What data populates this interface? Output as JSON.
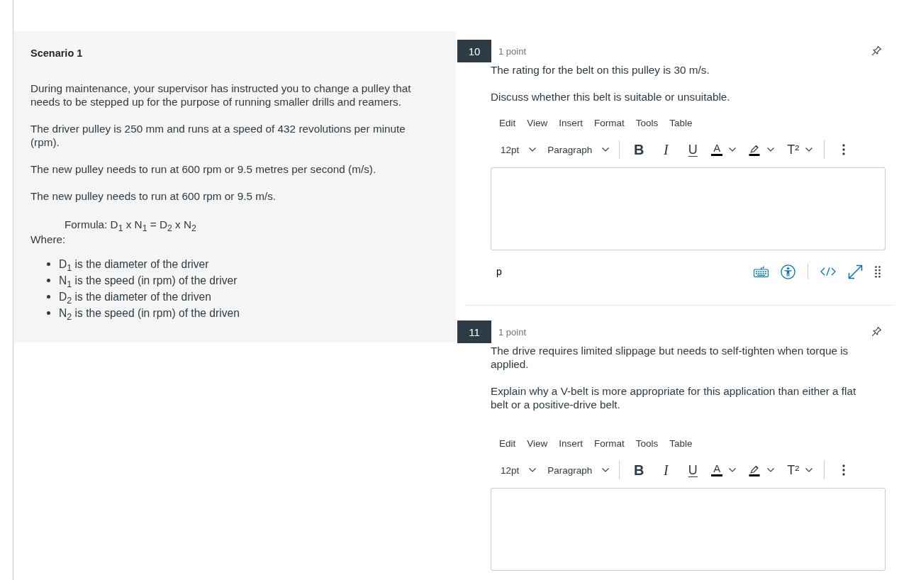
{
  "scenario": {
    "title": "Scenario 1",
    "paragraphs": [
      "During maintenance, your supervisor has instructed you to change a pulley that needs to be stepped up for the purpose of running smaller drills and reamers.",
      "The driver pulley is 250 mm and runs at a speed of 432 revolutions per minute (rpm).",
      "The new pulley needs to run at 600 rpm or 9.5 metres per second (m/s).",
      "The new pulley needs to run at 600 rpm or 9.5 m/s."
    ],
    "formula": "Formula: D$_{1}$ x N$_{1}$ = D$_{2}$ x N$_{2}$",
    "where": "Where:",
    "definitions": [
      "D$_{1}$ is the diameter of the driver",
      "N$_{1}$ is the speed (in rpm) of the driver",
      "D$_{2}$ is the diameter of the driven",
      "N$_{2}$ is the speed (in rpm) of the driven"
    ]
  },
  "questions": [
    {
      "number": "10",
      "points": "1 point",
      "paragraphs": [
        "The rating for the belt on this pulley is 30 m/s.",
        "Discuss whether this belt is suitable or unsuitable."
      ],
      "editor": {
        "menu": [
          "Edit",
          "View",
          "Insert",
          "Format",
          "Tools",
          "Table"
        ],
        "toolbar": [
          [
            {
              "kind": "font_size",
              "label": "12pt"
            },
            {
              "kind": "block_format",
              "label": "Paragraph"
            }
          ],
          [
            {
              "kind": "bold",
              "label": "B"
            },
            {
              "kind": "italic",
              "label": "I"
            },
            {
              "kind": "underline",
              "label": "U"
            },
            {
              "kind": "text_color",
              "label": "A"
            },
            {
              "kind": "highlight"
            },
            {
              "kind": "superscript",
              "label": "T²"
            }
          ],
          [
            {
              "kind": "more"
            }
          ]
        ],
        "status_path": "p"
      }
    },
    {
      "number": "11",
      "points": "1 point",
      "paragraphs": [
        "The drive requires limited slippage but needs to self-tighten when torque is applied.",
        "Explain why a V-belt is more appropriate for this application than either a flat belt or a positive-drive belt."
      ],
      "editor": {
        "menu": [
          "Edit",
          "View",
          "Insert",
          "Format",
          "Tools",
          "Table"
        ],
        "toolbar": [
          [
            {
              "kind": "font_size",
              "label": "12pt"
            },
            {
              "kind": "block_format",
              "label": "Paragraph"
            }
          ],
          [
            {
              "kind": "bold",
              "label": "B"
            },
            {
              "kind": "italic",
              "label": "I"
            },
            {
              "kind": "underline",
              "label": "U"
            },
            {
              "kind": "text_color",
              "label": "A"
            },
            {
              "kind": "highlight"
            },
            {
              "kind": "superscript",
              "label": "T²"
            }
          ],
          [
            {
              "kind": "more"
            }
          ]
        ]
      }
    }
  ]
}
